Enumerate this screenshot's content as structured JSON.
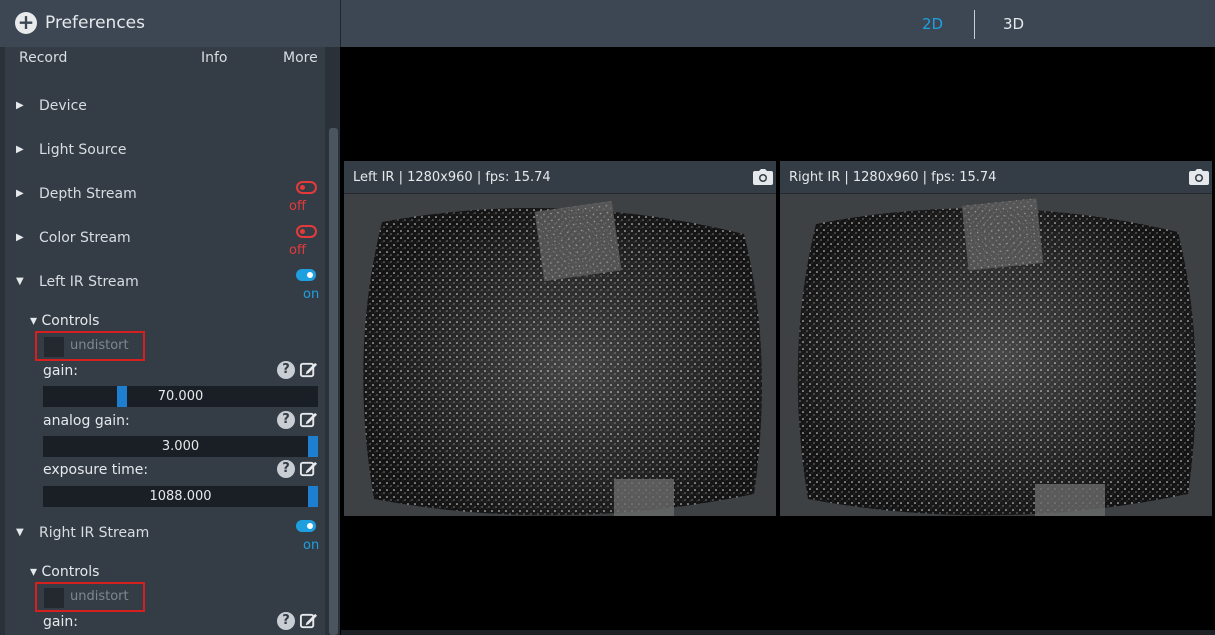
{
  "header": {
    "title": "Preferences",
    "tabs": [
      {
        "label": "2D",
        "active": true
      },
      {
        "label": "3D",
        "active": false
      }
    ]
  },
  "menu": [
    "Record",
    "Info",
    "More"
  ],
  "streams": [
    {
      "label": "Device"
    },
    {
      "label": "Light Source"
    },
    {
      "label": "Depth Stream",
      "state": "off"
    },
    {
      "label": "Color Stream",
      "state": "off"
    },
    {
      "label": "Left IR Stream",
      "state": "on"
    },
    {
      "label": "Right IR Stream",
      "state": "on"
    }
  ],
  "left_controls": {
    "title": "Controls",
    "undistort": "undistort",
    "params": [
      {
        "label": "gain:",
        "value": "70.000",
        "fraction": 0.28
      },
      {
        "label": "analog gain:",
        "value": "3.000",
        "fraction": 1.0
      },
      {
        "label": "exposure time:",
        "value": "1088.000",
        "fraction": 1.0
      }
    ]
  },
  "right_controls": {
    "title": "Controls",
    "undistort": "undistort",
    "params": [
      {
        "label": "gain:"
      }
    ]
  },
  "viewers": [
    {
      "title": "Left IR | 1280x960 | fps: 15.74"
    },
    {
      "title": "Right IR | 1280x960 | fps: 15.74"
    }
  ],
  "colors": {
    "accent": "#1ea0e0",
    "off": "#e53a3a",
    "highlight_box": "#d62020"
  }
}
